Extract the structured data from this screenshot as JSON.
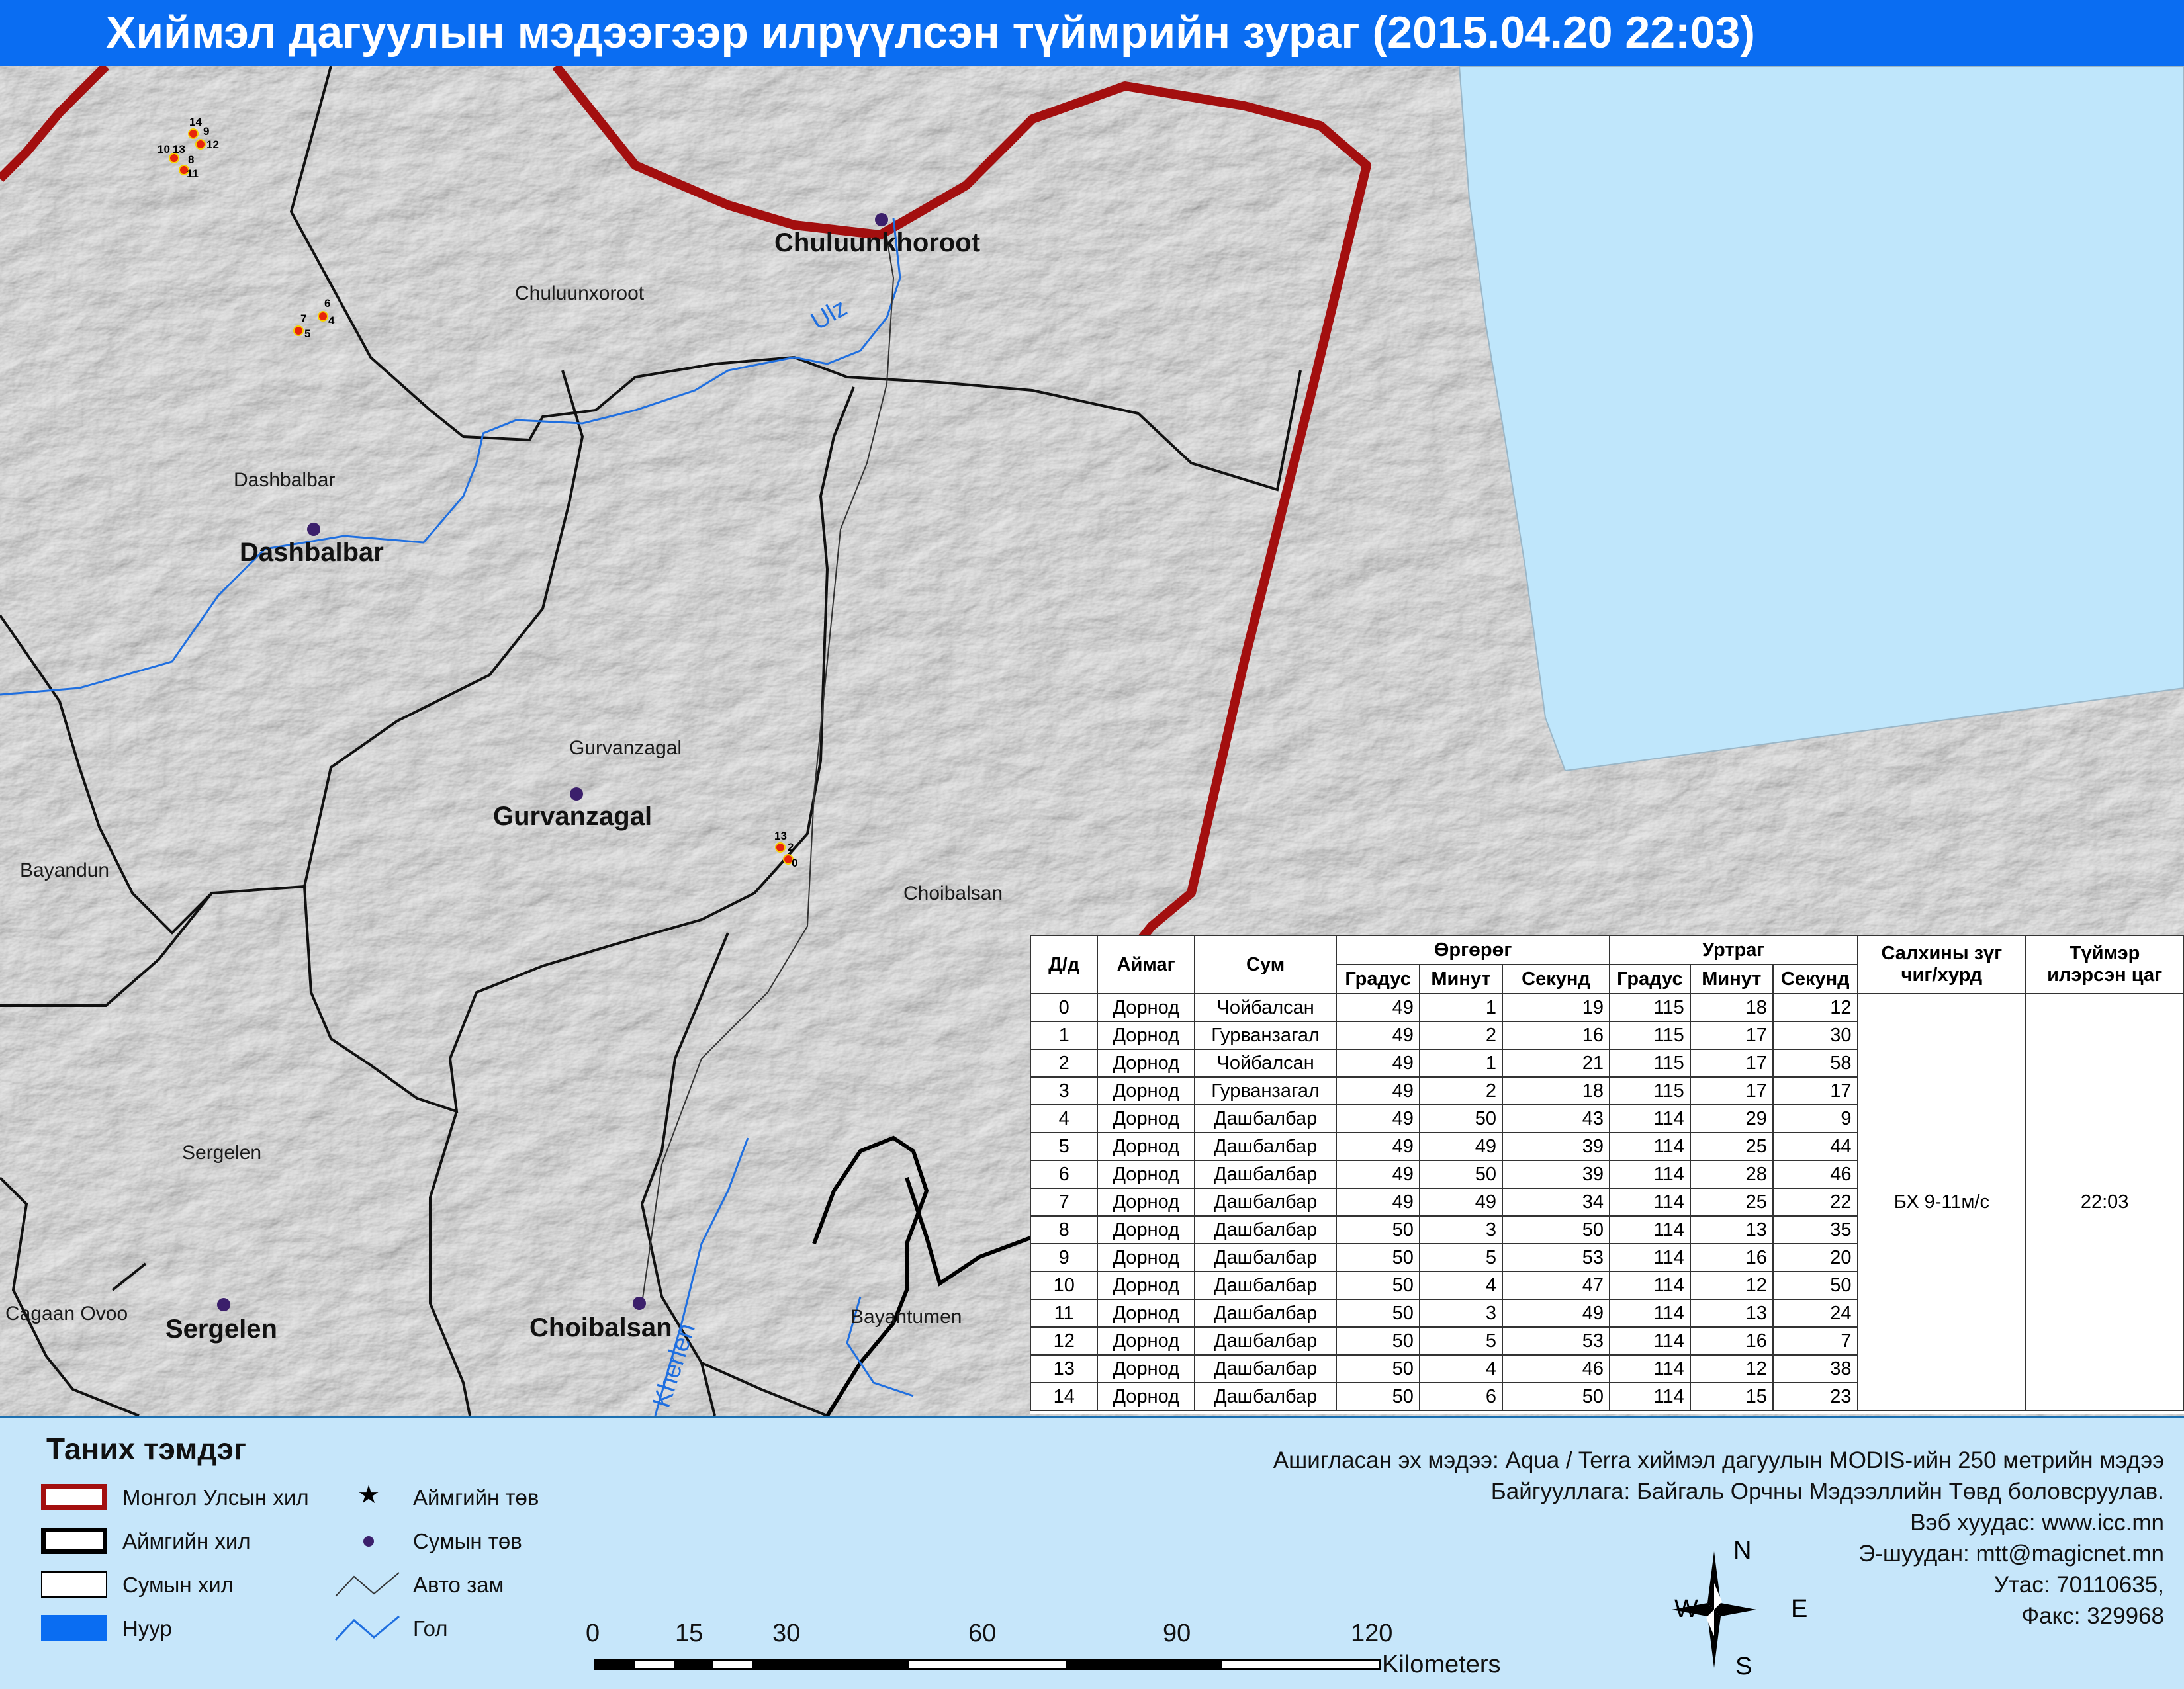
{
  "title": "Хиймэл дагуулын мэдээгээр илрүүлсэн түймрийн зураг  (2015.04.20 22:03)",
  "map": {
    "centers": [
      {
        "name": "Chuluunkhoroot"
      },
      {
        "name": "Dashbalbar"
      },
      {
        "name": "Gurvanzagal"
      },
      {
        "name": "Sergelen"
      },
      {
        "name": "Choibalsan"
      }
    ],
    "sum_labels": [
      "Chuluunxoroot",
      "Dashbalbar",
      "Gurvanzagal",
      "Bayandun",
      "Choibalsan",
      "Sergelen",
      "Cagaan Ovoo",
      "Bayantumen"
    ],
    "rivers": [
      "Ulz",
      "Kherlen"
    ],
    "fire_groups": [
      {
        "labels": [
          "14",
          "9",
          "12",
          "10",
          "13",
          "8",
          "11"
        ]
      },
      {
        "labels": [
          "6",
          "7",
          "4",
          "5"
        ]
      },
      {
        "labels": [
          "13",
          "2",
          "0"
        ]
      }
    ],
    "colors": {
      "country_border": "#a30f0f",
      "lake": "#bfe6fb",
      "river": "#1f6fe0",
      "fire": "#e8240c",
      "center": "#3b1f6b"
    }
  },
  "table": {
    "headers": {
      "no": "Д/д",
      "aimag": "Аймаг",
      "sum": "Сум",
      "lat": "Өргөрөг",
      "lon": "Уртраг",
      "deg": "Градус",
      "min": "Минут",
      "sec": "Секунд",
      "wind1": "Салхины зүг",
      "wind2": "чиг/хурд",
      "time1": "Түймэр",
      "time2": "илэрсэн цаг"
    },
    "wind": "БХ 9-11м/с",
    "time": "22:03",
    "rows": [
      [
        "0",
        "Дорнод",
        "Чойбалсан",
        "49",
        "1",
        "19",
        "115",
        "18",
        "12"
      ],
      [
        "1",
        "Дорнод",
        "Гурванзагал",
        "49",
        "2",
        "16",
        "115",
        "17",
        "30"
      ],
      [
        "2",
        "Дорнод",
        "Чойбалсан",
        "49",
        "1",
        "21",
        "115",
        "17",
        "58"
      ],
      [
        "3",
        "Дорнод",
        "Гурванзагал",
        "49",
        "2",
        "18",
        "115",
        "17",
        "17"
      ],
      [
        "4",
        "Дорнод",
        "Дашбалбар",
        "49",
        "50",
        "43",
        "114",
        "29",
        "9"
      ],
      [
        "5",
        "Дорнод",
        "Дашбалбар",
        "49",
        "49",
        "39",
        "114",
        "25",
        "44"
      ],
      [
        "6",
        "Дорнод",
        "Дашбалбар",
        "49",
        "50",
        "39",
        "114",
        "28",
        "46"
      ],
      [
        "7",
        "Дорнод",
        "Дашбалбар",
        "49",
        "49",
        "34",
        "114",
        "25",
        "22"
      ],
      [
        "8",
        "Дорнод",
        "Дашбалбар",
        "50",
        "3",
        "50",
        "114",
        "13",
        "35"
      ],
      [
        "9",
        "Дорнод",
        "Дашбалбар",
        "50",
        "5",
        "53",
        "114",
        "16",
        "20"
      ],
      [
        "10",
        "Дорнод",
        "Дашбалбар",
        "50",
        "4",
        "47",
        "114",
        "12",
        "50"
      ],
      [
        "11",
        "Дорнод",
        "Дашбалбар",
        "50",
        "3",
        "49",
        "114",
        "13",
        "24"
      ],
      [
        "12",
        "Дорнод",
        "Дашбалбар",
        "50",
        "5",
        "53",
        "114",
        "16",
        "7"
      ],
      [
        "13",
        "Дорнод",
        "Дашбалбар",
        "50",
        "4",
        "46",
        "114",
        "12",
        "38"
      ],
      [
        "14",
        "Дорнод",
        "Дашбалбар",
        "50",
        "6",
        "50",
        "114",
        "15",
        "23"
      ]
    ]
  },
  "legend": {
    "title": "Таних тэмдэг",
    "country_border": "Монгол Улсын хил",
    "aimag_border": "Аймгийн хил",
    "sum_border": "Сумын хил",
    "lake": "Нуур",
    "aimag_center": "Аймгийн төв",
    "sum_center": "Сумын төв",
    "road": "Авто зам",
    "river": "Гол"
  },
  "info": {
    "line1": "Ашигласан эх мэдээ: Aqua / Terra хиймэл дагуулын MODIS-ийн 250 метрийн мэдээ",
    "line2": "Байгууллага: Байгаль Орчны Мэдээллийн Төвд боловсруулав.",
    "line3": "Вэб хуудас: www.icc.mn",
    "line4": "Э-шуудан: mtt@magicnet.mn",
    "line5": "Утас: 70110635,",
    "line6": "Факс: 329968"
  },
  "scale": {
    "ticks": [
      "0",
      "15",
      "30",
      "60",
      "90",
      "120"
    ],
    "unit": "Kilometers"
  },
  "compass": {
    "n": "N",
    "s": "S",
    "e": "E",
    "w": "W"
  }
}
